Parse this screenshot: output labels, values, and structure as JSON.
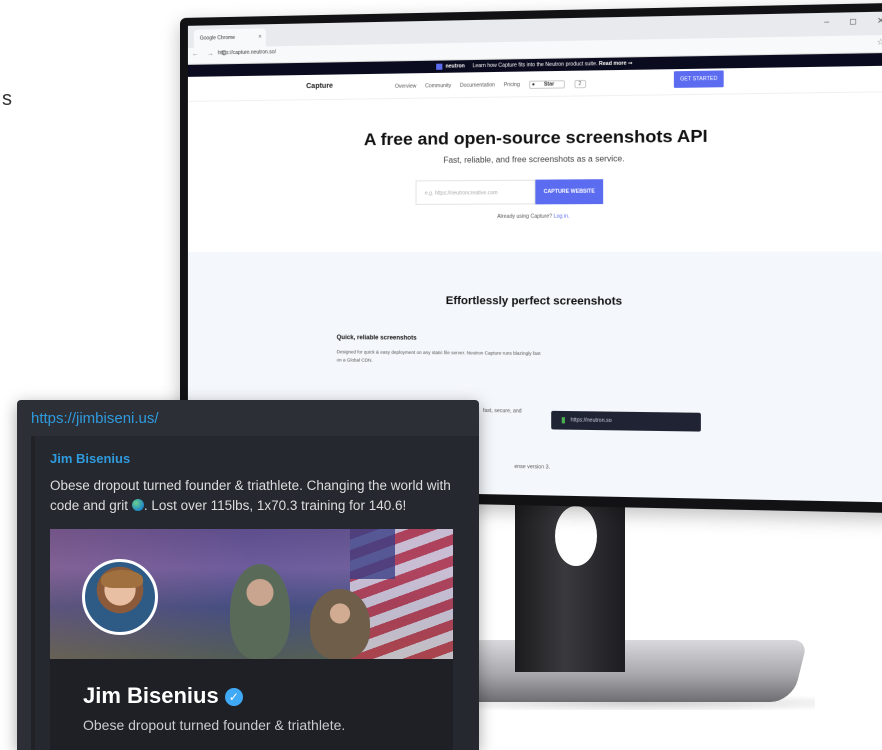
{
  "stray_char": "s",
  "browser": {
    "tab_title": "Google Chrome",
    "tab_close": "×",
    "window_controls": "‒ ◻ ✕",
    "nav": "← → C",
    "url": "https://capture.neutron.so/",
    "star_icon": "☆",
    "menu_icon": "⋮"
  },
  "promo": {
    "brand": "neutron",
    "text": "Learn how Capture fits into the Neutron product suite.",
    "link": "Read more ⇒"
  },
  "site": {
    "logo": "Capture",
    "links": [
      "Overview",
      "Community",
      "Documentation",
      "Pricing"
    ],
    "github_star": "Star",
    "github_count": "2",
    "get_started": "GET STARTED"
  },
  "hero": {
    "title": "A free and open-source screenshots API",
    "subtitle": "Fast, reliable, and free screenshots as a service.",
    "input_placeholder": "e.g. https://neutroncreative.com",
    "button": "CAPTURE WEBSITE",
    "login_prefix": "Already using Capture?",
    "login_link": "Log in."
  },
  "features": {
    "heading": "Effortlessly perfect screenshots",
    "item_title": "Quick, reliable screenshots",
    "item_desc": "Designed for quick & easy deployment on any static file server. Neutron Capture runs blazingly fast on a Global CDN.",
    "fragment_1": "fast, secure, and",
    "code_url": "https://neutron.so",
    "fragment_2": "ense version 3."
  },
  "embed": {
    "url": "https://jimbiseni.us/",
    "title": "Jim Bisenius",
    "description_before_emoji": "Obese dropout turned founder & triathlete. Changing the world with code and grit ",
    "description_after_emoji": ". Lost over 115lbs, 1x70.3 training for 140.6!",
    "banner_name": "Jim Bisenius",
    "verified_icon": "✓",
    "banner_desc": "Obese dropout turned founder & triathlete."
  }
}
